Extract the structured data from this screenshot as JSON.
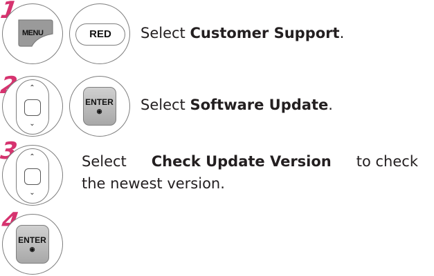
{
  "steps": [
    {
      "number": "1",
      "keys": {
        "menu": "MENU",
        "red": "RED"
      },
      "text_prefix": "Select ",
      "text_bold": "Customer Support",
      "text_suffix": "."
    },
    {
      "number": "2",
      "keys": {
        "enter": "ENTER",
        "enter_dot": "◉"
      },
      "text_prefix": "Select ",
      "text_bold": "Software Update",
      "text_suffix": "."
    },
    {
      "number": "3",
      "text_prefix": "Select ",
      "text_bold": "Check Update Version",
      "text_suffix": " to check",
      "text_line2": "the newest version."
    },
    {
      "number": "4",
      "keys": {
        "enter": "ENTER",
        "enter_dot": "◉"
      }
    }
  ],
  "icons": {
    "up_arrow": "⌃",
    "down_arrow": "⌄"
  },
  "colors": {
    "step_number": "#d6336f",
    "button_border": "#7d7d7d",
    "menu_key": "#9a9a9a"
  }
}
